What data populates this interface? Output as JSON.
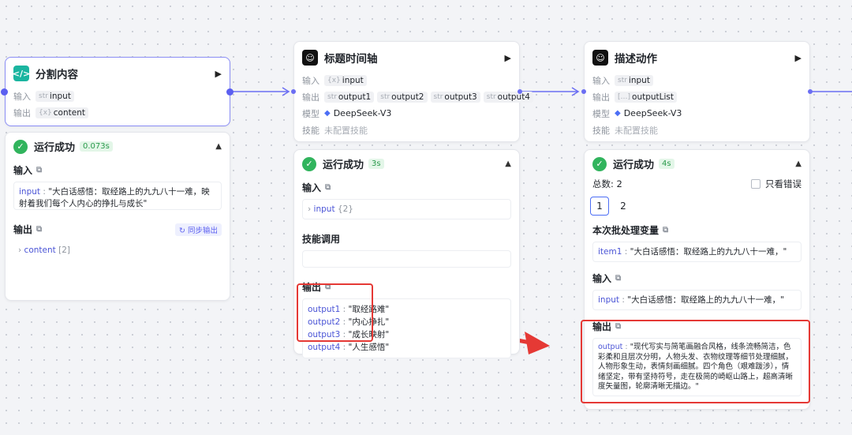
{
  "colors": {
    "accent": "#5b5ff0",
    "success": "#31b45d",
    "annotation": "#e53935"
  },
  "labels": {
    "input": "输入",
    "output": "输出",
    "model": "模型",
    "skill": "技能"
  },
  "node1": {
    "title": "分割内容",
    "icon": "code-icon",
    "input_type": "str",
    "input_name": "input",
    "output_type": "{x}",
    "output_name": "content",
    "result": {
      "status": "运行成功",
      "time": "0.073s",
      "input_label": "输入",
      "input_key": "input",
      "input_value": "\"大白话感悟：取经路上的九九八十一难，映射着我们每个人内心的挣扎与成长\"",
      "output_label": "输出",
      "sync_label": "同步输出",
      "output_key": "content",
      "output_count": "[2]"
    }
  },
  "node2": {
    "title": "标题时间轴",
    "icon": "ai-icon",
    "input_type": "{x}",
    "input_name": "input",
    "outputs": [
      {
        "type": "str",
        "name": "output1"
      },
      {
        "type": "str",
        "name": "output2"
      },
      {
        "type": "str",
        "name": "output3"
      },
      {
        "type": "str",
        "name": "output4"
      }
    ],
    "model": "DeepSeek-V3",
    "skill": "未配置技能",
    "result": {
      "status": "运行成功",
      "time": "3s",
      "input_label": "输入",
      "input_key": "input",
      "input_count": "{2}",
      "skill_label": "技能调用",
      "output_label": "输出",
      "outputs": [
        {
          "key": "output1",
          "value": "\"取经路难\""
        },
        {
          "key": "output2",
          "value": "\"内心挣扎\""
        },
        {
          "key": "output3",
          "value": "\"成长映射\""
        },
        {
          "key": "output4",
          "value": "\"人生感悟\""
        }
      ]
    }
  },
  "node3": {
    "title": "描述动作",
    "icon": "ai-icon",
    "input_type": "str",
    "input_name": "input",
    "output_type": "[…]",
    "output_name": "outputList",
    "model": "DeepSeek-V3",
    "skill": "未配置技能",
    "result": {
      "status": "运行成功",
      "time": "4s",
      "total": "总数: 2",
      "only_errors": "只看错误",
      "pages": [
        "1",
        "2"
      ],
      "batch_label": "本次批处理变量",
      "batch_key": "item1",
      "batch_value": "\"大白话感悟：取经路上的九九八十一难，\"",
      "input_label": "输入",
      "input_key": "input",
      "input_value": "\"大白话感悟：取经路上的九九八十一难，\"",
      "output_label": "输出",
      "output_key": "output",
      "output_value": "\"现代写实与简笔画融合风格，线条流畅简洁，色彩柔和且层次分明，人物头发、衣物纹理等细节处理细腻，人物形象生动，表情刻画细腻。四个角色（艰难跋涉），情绪坚定，带有坚持符号，走在极简的崎岖山路上，超高清晰度矢量图，轮廓清晰无描边。\""
    }
  }
}
